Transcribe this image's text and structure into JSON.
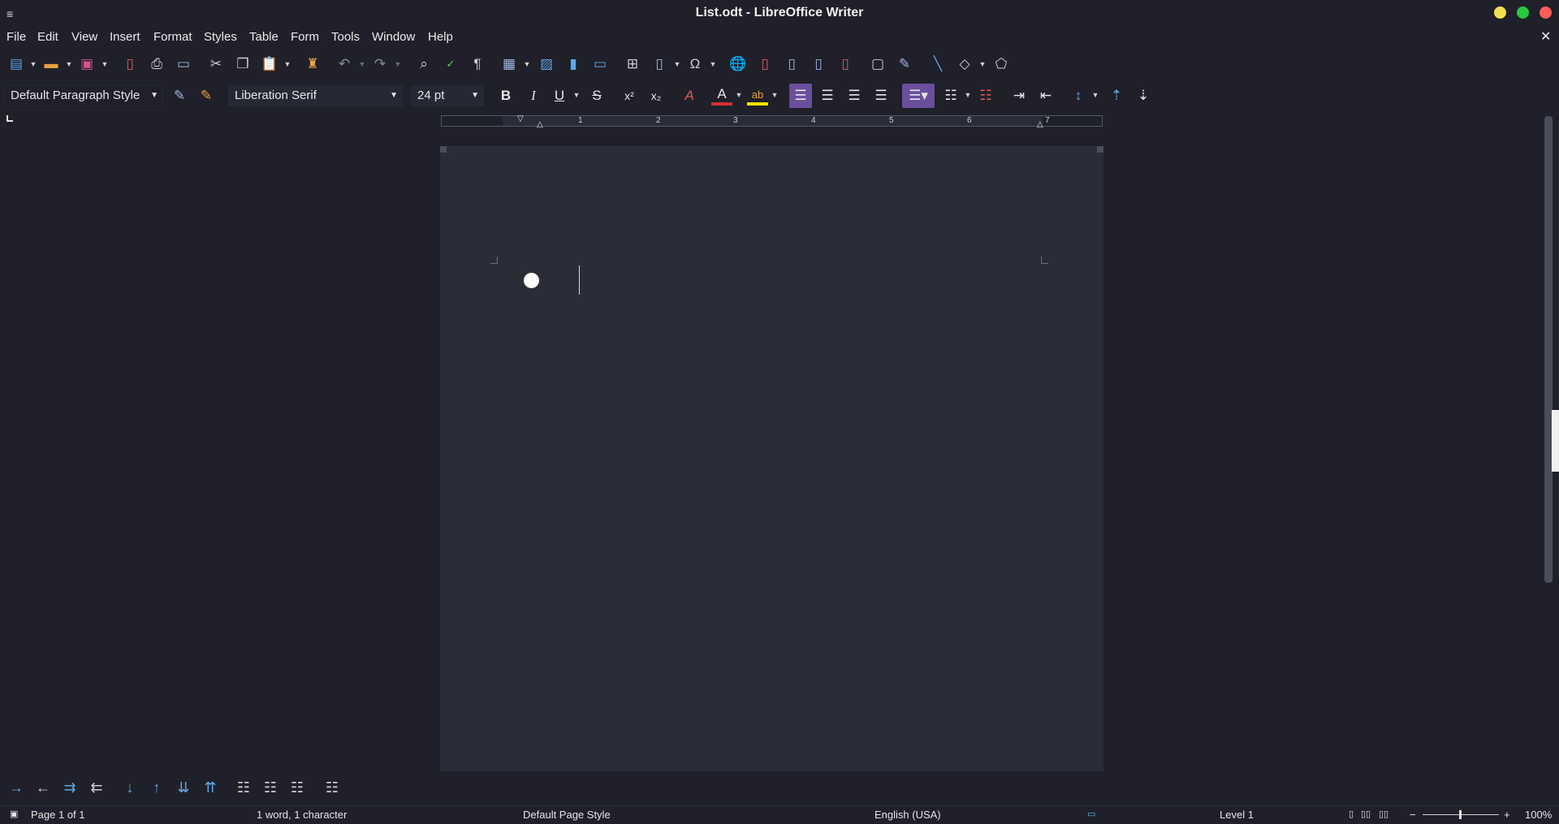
{
  "window": {
    "title": "List.odt - LibreOffice Writer"
  },
  "menu": [
    "File",
    "Edit",
    "View",
    "Insert",
    "Format",
    "Styles",
    "Table",
    "Form",
    "Tools",
    "Window",
    "Help"
  ],
  "formatting": {
    "paragraph_style": "Default Paragraph Style",
    "font_name": "Liberation Serif",
    "font_size": "24 pt",
    "bold_glyph": "B",
    "italic_glyph": "I",
    "underline_glyph": "U",
    "strike_glyph": "S"
  },
  "ruler": {
    "numbers": [
      "1",
      "2",
      "3",
      "4",
      "5",
      "6",
      "7"
    ]
  },
  "statusbar": {
    "page": "Page 1 of 1",
    "word_count": "1 word, 1 character",
    "page_style": "Default Page Style",
    "language": "English (USA)",
    "outline_level": "Level 1",
    "zoom": "100%"
  },
  "colors": {
    "background": "#1f2029",
    "page": "#2a2c37",
    "accent_active": "#6a4f9c",
    "font_color_bar": "#d22f2f",
    "highlight_bar": "#f5e400",
    "close_dot": "#ff5f57",
    "maximize_dot": "#28c840",
    "minimize_dot": "#f0e050"
  }
}
